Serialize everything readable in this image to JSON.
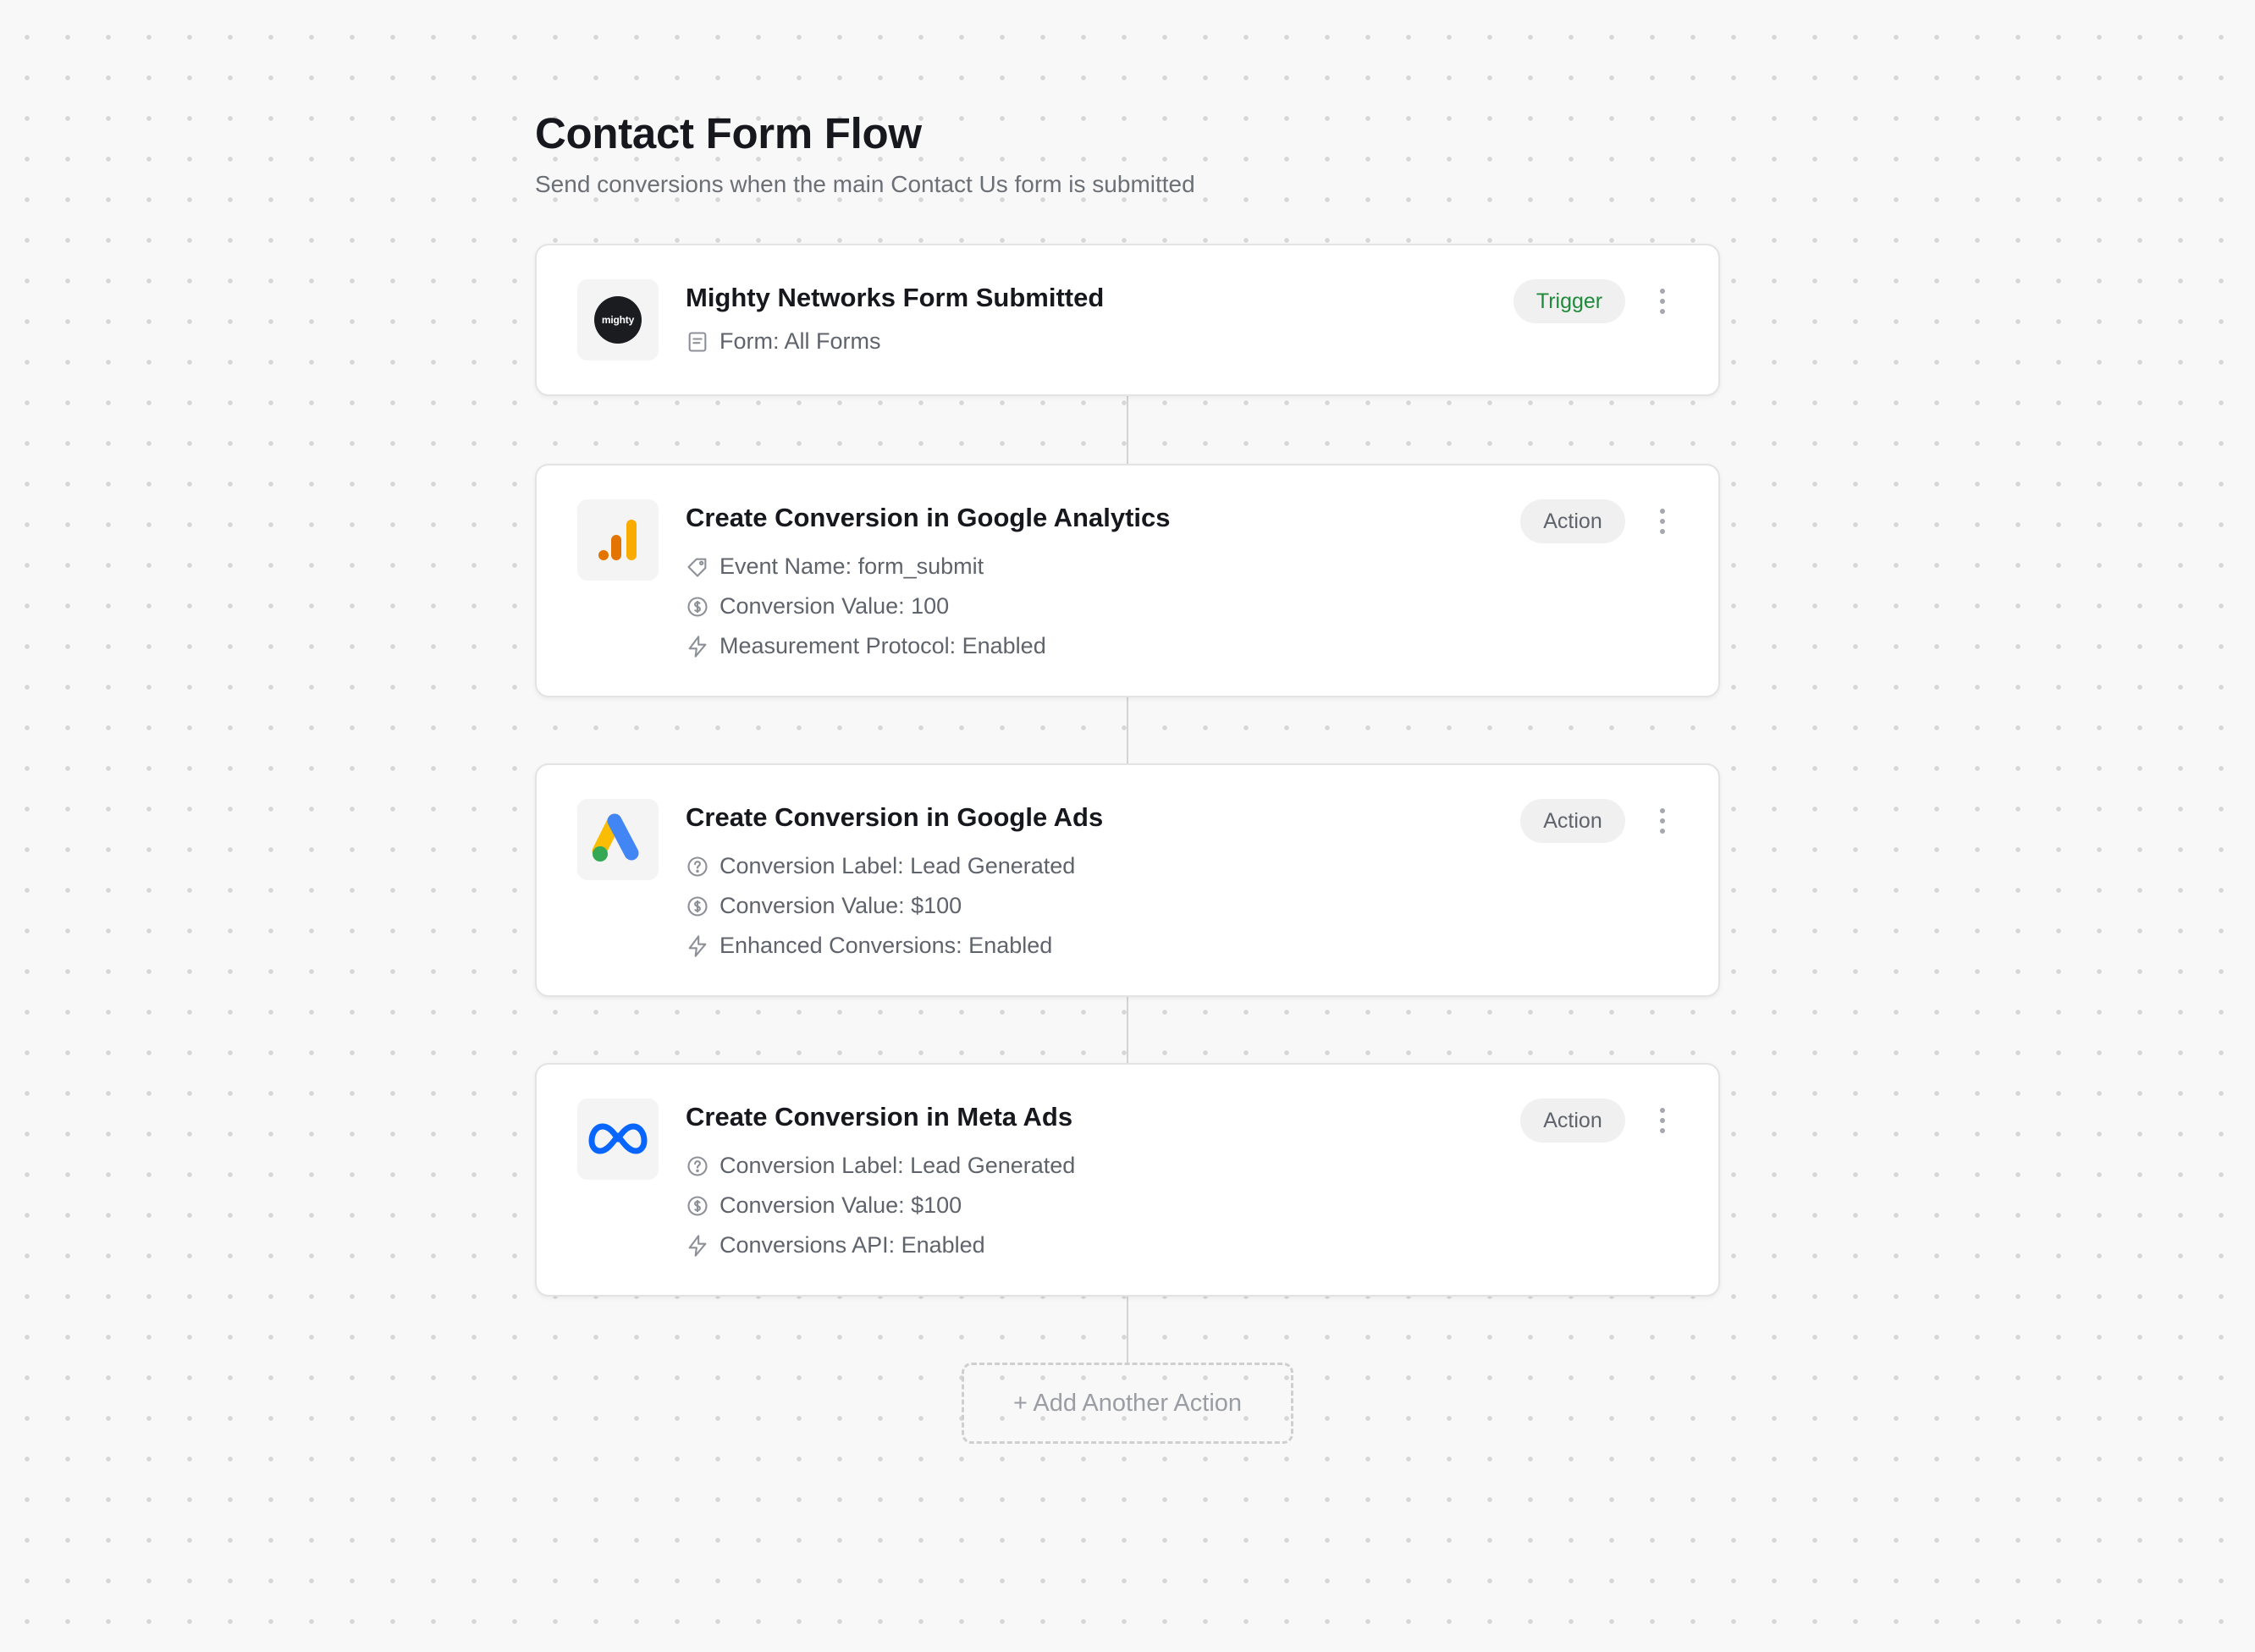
{
  "header": {
    "title": "Contact Form Flow",
    "subtitle": "Send conversions when the main Contact Us form is submitted"
  },
  "steps": [
    {
      "app": "Mighty Networks",
      "logo_text": "mighty",
      "title": "Mighty Networks Form Submitted",
      "badge": "Trigger",
      "details": [
        {
          "icon": "form-icon",
          "text": "Form: All Forms"
        }
      ]
    },
    {
      "app": "Google Analytics",
      "title": "Create Conversion in Google Analytics",
      "badge": "Action",
      "details": [
        {
          "icon": "tag-icon",
          "text": "Event Name: form_submit"
        },
        {
          "icon": "dollar-icon",
          "text": "Conversion Value: 100"
        },
        {
          "icon": "lightning-icon",
          "text": "Measurement Protocol: Enabled"
        }
      ]
    },
    {
      "app": "Google Ads",
      "title": "Create Conversion in Google Ads",
      "badge": "Action",
      "details": [
        {
          "icon": "question-icon",
          "text": "Conversion Label: Lead Generated"
        },
        {
          "icon": "dollar-icon",
          "text": "Conversion Value: $100"
        },
        {
          "icon": "lightning-icon",
          "text": "Enhanced Conversions: Enabled"
        }
      ]
    },
    {
      "app": "Meta Ads",
      "title": "Create Conversion in Meta Ads",
      "badge": "Action",
      "details": [
        {
          "icon": "question-icon",
          "text": "Conversion Label: Lead Generated"
        },
        {
          "icon": "dollar-icon",
          "text": "Conversion Value: $100"
        },
        {
          "icon": "lightning-icon",
          "text": "Conversions API: Enabled"
        }
      ]
    }
  ],
  "add_action_label": "+ Add Another Action",
  "colors": {
    "trigger_badge_text": "#1f8a3b",
    "google_analytics": [
      "#e37400",
      "#f9ab00"
    ],
    "google_ads": [
      "#fbbc04",
      "#4285f4",
      "#34a853"
    ],
    "meta": "#0866ff"
  }
}
